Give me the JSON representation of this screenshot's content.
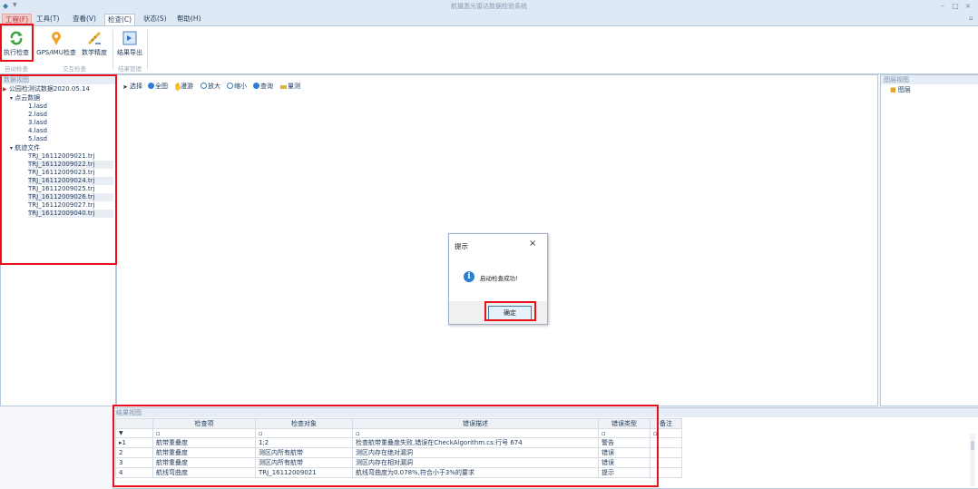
{
  "window": {
    "title": "航摄激光雷达数据检验系统",
    "controls": [
      "–",
      "□",
      "×"
    ]
  },
  "menu": [
    "工程(F)",
    "工具(T)",
    "查看(V)",
    "检查(C)",
    "状态(S)",
    "帮助(H)"
  ],
  "ribbon": {
    "buttons": [
      {
        "label": "执行检查",
        "icon": "refresh-icon"
      },
      {
        "label": "GPS/IMU检查",
        "icon": "gps-icon"
      },
      {
        "label": "数学精度",
        "icon": "ruler-icon"
      },
      {
        "label": "结果导出",
        "icon": "export-icon"
      }
    ],
    "groups": [
      "自动检查",
      "交互检查",
      "结果管理"
    ]
  },
  "data_view": {
    "title": "数据视图",
    "root": "公园检测试数据2020.05.14",
    "cloud_folder": "点云数据",
    "cloud_files": [
      "1.lasd",
      "2.lasd",
      "3.lasd",
      "4.lasd",
      "5.lasd"
    ],
    "track_folder": "航迹文件",
    "track_files": [
      "TRJ_16112009021.trj",
      "TRJ_16112009022.trj",
      "TRJ_16112009023.trj",
      "TRJ_16112009024.trj",
      "TRJ_16112009025.trj",
      "TRJ_16112009026.trj",
      "TRJ_16112009027.trj",
      "TRJ_16112009040.trj"
    ]
  },
  "map_toolbar": [
    "选择",
    "全图",
    "漫游",
    "放大",
    "缩小",
    "查询",
    "量测"
  ],
  "layer_view": {
    "title": "图层视图",
    "item": "图层"
  },
  "dialog": {
    "title": "提示",
    "message": "启动检查成功!",
    "ok": "确定"
  },
  "results": {
    "title": "结果视图",
    "columns": [
      "检查项",
      "检查对象",
      "错误描述",
      "错误类型",
      "备注"
    ],
    "rows": [
      {
        "num": "1",
        "item": "航带重叠度",
        "object": "1;2",
        "desc": "检查航带重叠度失败,错误在CheckAlgorithm.cs:行号 674",
        "type": "警告",
        "note": ""
      },
      {
        "num": "2",
        "item": "航带重叠度",
        "object": "测区内所有航带",
        "desc": "测区内存在绝对漏洞",
        "type": "错误",
        "note": ""
      },
      {
        "num": "3",
        "item": "航带重叠度",
        "object": "测区内所有航带",
        "desc": "测区内存在相对漏洞",
        "type": "错误",
        "note": ""
      },
      {
        "num": "4",
        "item": "航线弯曲度",
        "object": "TRJ_16112009021",
        "desc": "航线弯曲度为0.078%,符合小于3%的要求",
        "type": "提示",
        "note": ""
      }
    ]
  },
  "colors": {
    "highlight": "#e8101a",
    "accent": "#2a7fd4"
  }
}
